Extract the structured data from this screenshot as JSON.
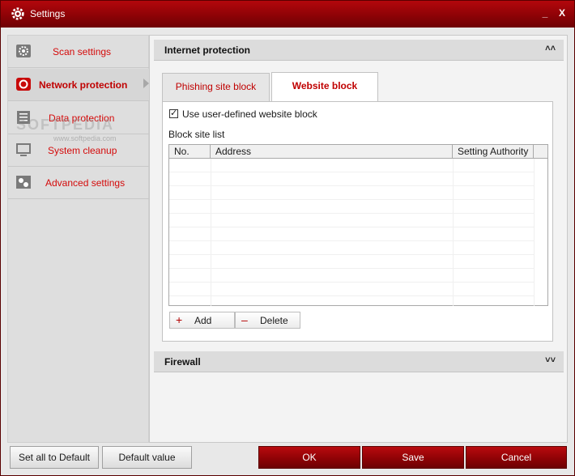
{
  "window": {
    "title": "Settings",
    "min": "_",
    "close": "X"
  },
  "sidebar": {
    "items": [
      {
        "label": "Scan settings"
      },
      {
        "label": "Network protection"
      },
      {
        "label": "Data protection"
      },
      {
        "label": "System cleanup"
      },
      {
        "label": "Advanced settings"
      }
    ],
    "active_index": 1,
    "watermark": "SOFTPEDIA",
    "watermark_url": "www.softpedia.com"
  },
  "internet_protection": {
    "title": "Internet protection",
    "tabs": [
      {
        "label": "Phishing site block"
      },
      {
        "label": "Website block"
      }
    ],
    "active_tab": 1,
    "checkbox_label": "Use user-defined website block",
    "checkbox_checked": true,
    "list_label": "Block site list",
    "columns": [
      "No.",
      "Address",
      "Setting Authority"
    ],
    "rows": [],
    "add_label": "Add",
    "delete_label": "Delete"
  },
  "firewall": {
    "title": "Firewall"
  },
  "footer": {
    "set_all_default": "Set all to Default",
    "default_value": "Default value",
    "ok": "OK",
    "save": "Save",
    "cancel": "Cancel"
  }
}
